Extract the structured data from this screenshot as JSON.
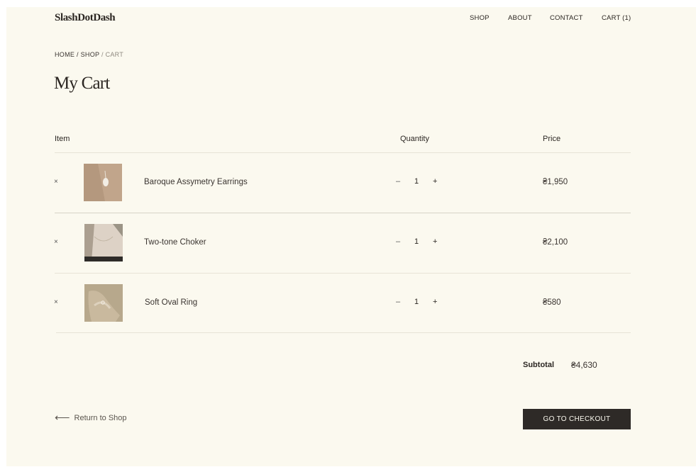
{
  "header": {
    "logo": "SlashDotDash",
    "nav": [
      "SHOP",
      "ABOUT",
      "CONTACT",
      "CART (1)"
    ]
  },
  "breadcrumb": {
    "home": "HOME",
    "shop": "SHOP",
    "current": "CART",
    "sep": " / "
  },
  "page_title": "My Cart",
  "table": {
    "headers": {
      "item": "Item",
      "quantity": "Quantity",
      "price": "Price"
    },
    "rows": [
      {
        "name": "Baroque Assymetry Earrings",
        "qty": "1",
        "price": "₴1,950",
        "remove": "×",
        "minus": "–",
        "plus": "+",
        "thumb_color": "#b89c83"
      },
      {
        "name": "Two-tone Choker",
        "qty": "1",
        "price": "₴2,100",
        "remove": "×",
        "minus": "–",
        "plus": "+",
        "thumb_color": "#d9ccc0"
      },
      {
        "name": "Soft Oval Ring",
        "qty": "1",
        "price": "₴580",
        "remove": "×",
        "minus": "–",
        "plus": "+",
        "thumb_color": "#b7a88c"
      }
    ]
  },
  "summary": {
    "subtotal_label": "Subtotal",
    "subtotal_value": "₴4,630"
  },
  "actions": {
    "return_label": "Return to Shop",
    "return_arrow": "⟵",
    "checkout_label": "GO TO CHECKOUT"
  },
  "colors": {
    "background": "#fbf9ef",
    "button": "#2e2a27",
    "text": "#2b2622"
  }
}
